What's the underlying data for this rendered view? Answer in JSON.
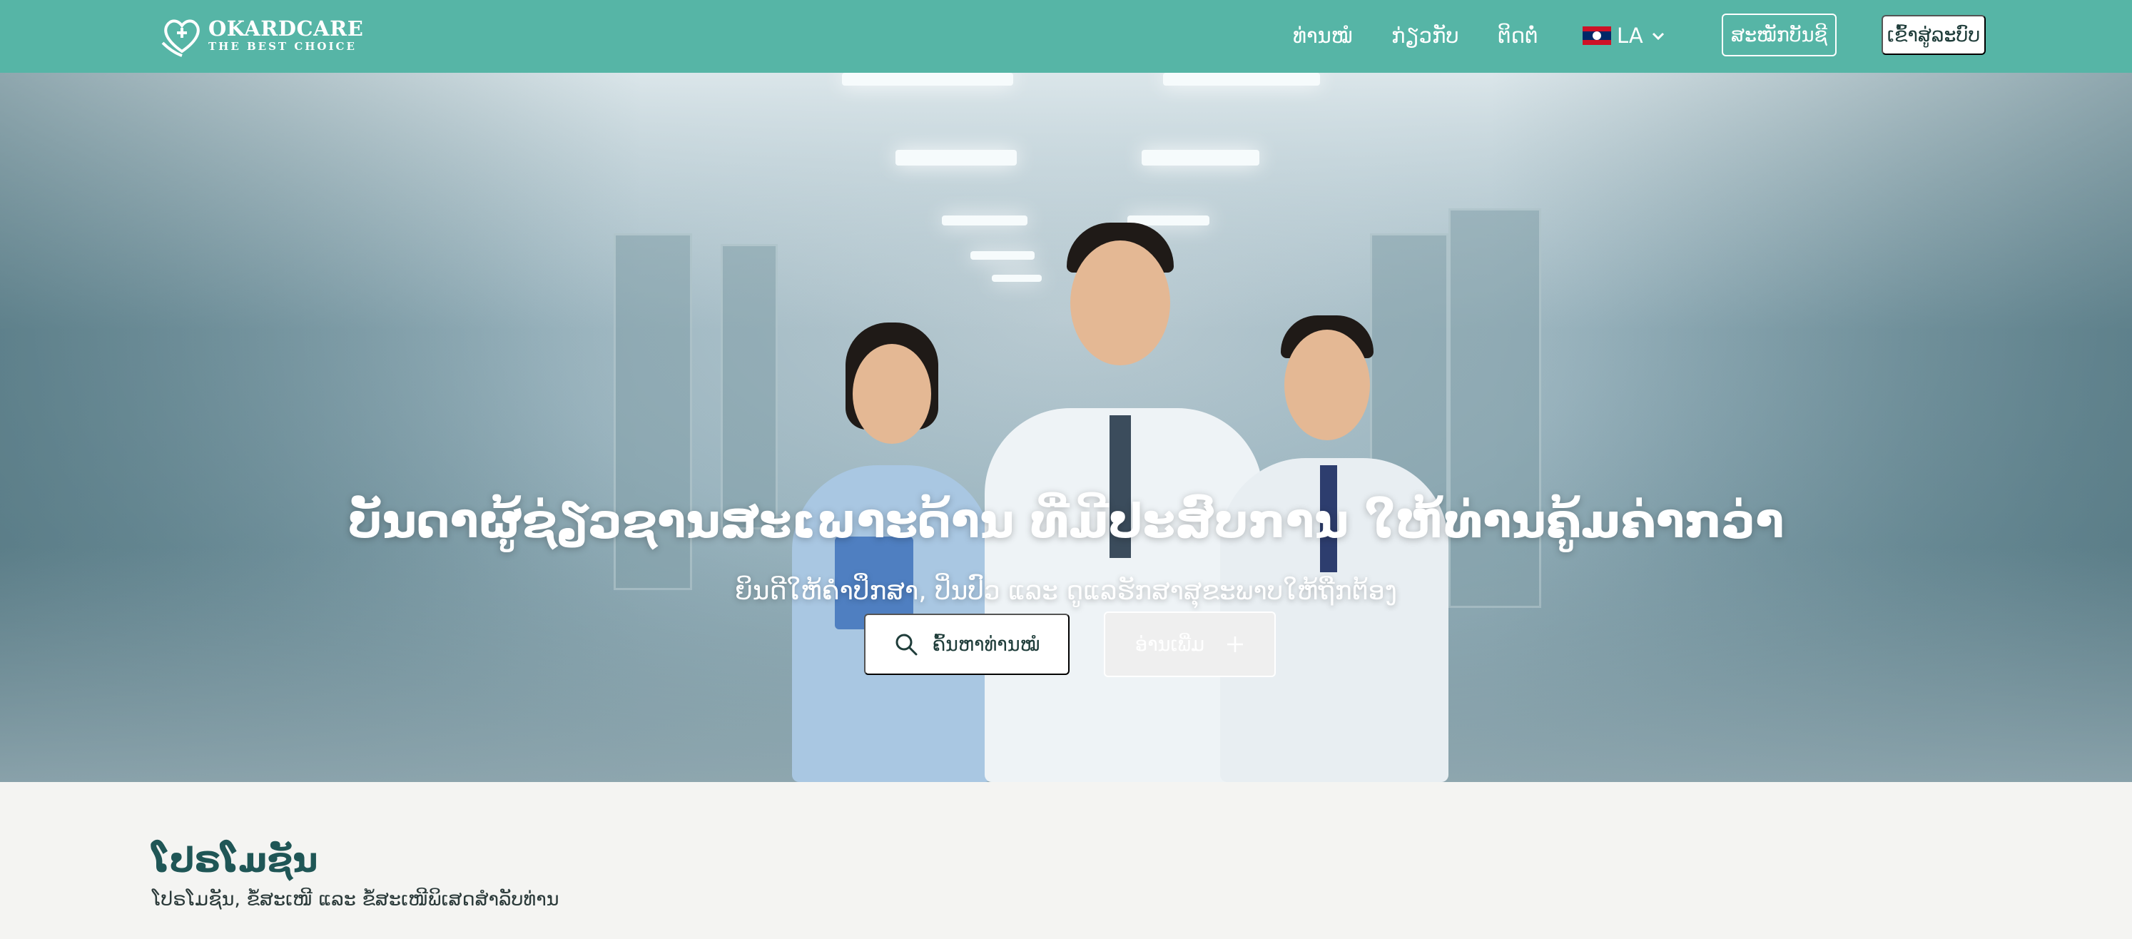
{
  "header": {
    "logo": {
      "name": "OKARDCARE",
      "tagline": "THE BEST CHOICE"
    },
    "nav": {
      "home": "ທ່ານໝໍ",
      "about": "ກ່ຽວກັບ",
      "contact": "ຕິດຕໍ່"
    },
    "language": {
      "code": "LA",
      "flag": "laos-flag"
    },
    "register_label": "ສະໝັກບັນຊີ",
    "login_label": "ເຂົ້າສູ່ລະບົບ"
  },
  "hero": {
    "title": "ບັນດາຜູ້ຊ່ຽວຊານສະເພາະດ້ານ ທີ່ມີປະສົບການ ໃຫ້ທ່ານຄູ້ມຄ່າກວ່າ",
    "subtitle": "ຍິນດີໃຫ້ຄຳປຶກສາ, ປິ່ນປົວ ແລະ ດູແລຮັກສາສຸຂະພາບໃຫ້ຖືກຕ້ອງ",
    "search_button": "ຄົ້ນຫາທ່ານໝໍ",
    "more_button": "ອ່ານເພີ່ມ"
  },
  "promotions": {
    "title": "ໂປຣໂມຊັນ",
    "subtitle": "ໂປຣໂມຊັນ, ຂໍ້ສະເໜີ ແລະ ຂໍ້ສະເໜີພິເສດສຳລັບທ່ານ"
  },
  "colors": {
    "header_bg": "#56b5a6",
    "accent_dark": "#1f5656",
    "page_bg": "#f4f4f2"
  }
}
